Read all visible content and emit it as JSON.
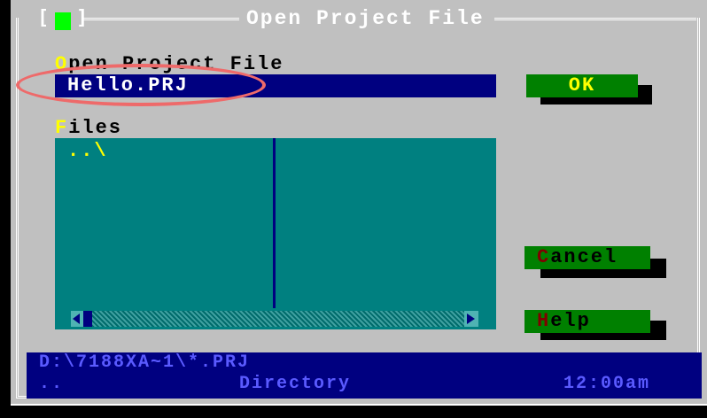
{
  "dialog": {
    "title": "Open Project File",
    "close_glyph": "close-box"
  },
  "open_field": {
    "label_hot": "O",
    "label_rest": "pen Project File",
    "value": "Hello.PRJ"
  },
  "files": {
    "label_hot": "F",
    "label_rest": "iles",
    "items": [
      "..\\"
    ]
  },
  "buttons": {
    "ok": "OK",
    "cancel_hot": "C",
    "cancel_rest": "ancel",
    "help_hot": "H",
    "help_rest": "elp"
  },
  "status": {
    "path": "D:\\7188XA~1\\*.PRJ",
    "name": "..",
    "type": "Directory",
    "time": "12:00am"
  },
  "colors": {
    "dialog_bg": "#c0c0c0",
    "input_bg": "#000080",
    "list_bg": "#008080",
    "button_bg": "#008000",
    "hotkey": "#ffff00",
    "highlight_annotation": "#ee6a6a"
  }
}
